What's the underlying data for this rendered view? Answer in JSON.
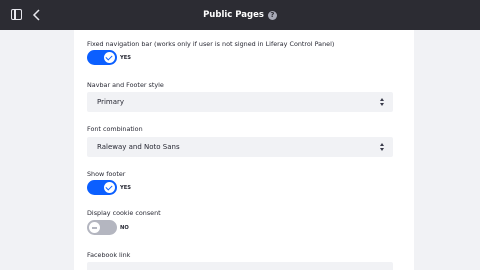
{
  "topbar": {
    "title": "Public Pages",
    "help_symbol": "?",
    "icons": [
      "panel-toggle-icon",
      "chevron-left-icon",
      "question-circle-icon"
    ]
  },
  "form": {
    "fixed_navbar": {
      "label": "Fixed navigation bar (works only if user is not signed in Liferay Control Panel)",
      "state_text": "YES",
      "checked": true
    },
    "navbar_footer_style": {
      "label": "Navbar and Footer style",
      "value": "Primary"
    },
    "font_combination": {
      "label": "Font combination",
      "value": "Raleway and Noto Sans"
    },
    "show_footer": {
      "label": "Show footer",
      "state_text": "YES",
      "checked": true
    },
    "cookie_consent": {
      "label": "Display cookie consent",
      "state_text": "NO",
      "checked": false
    },
    "facebook_link": {
      "label": "Facebook link",
      "value": ""
    }
  },
  "colors": {
    "topbar_bg": "#2c2c33",
    "page_bg": "#f1f2f5",
    "toggle_on": "#0b5fff",
    "toggle_off": "#b4b6c0"
  }
}
